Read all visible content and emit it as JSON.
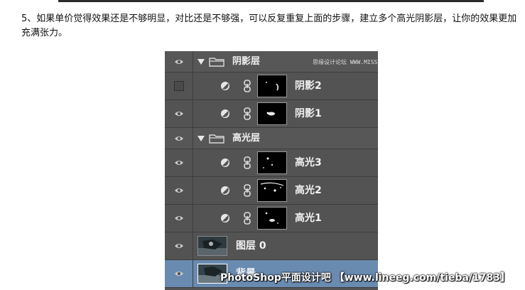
{
  "instruction": "5、如果单价觉得效果还是不够明显，对比还是不够强，可以反复重复上面的步骤，建立多个高光阴影层，让你的效果更加充满张力。",
  "layers": {
    "shadow_group": {
      "label": "阴影层",
      "visible": true,
      "expanded": true
    },
    "shadow2": {
      "label": "阴影2",
      "visible": false
    },
    "shadow1": {
      "label": "阴影1",
      "visible": true
    },
    "highlight_group": {
      "label": "高光层",
      "visible": true,
      "expanded": true
    },
    "highlight3": {
      "label": "高光3",
      "visible": true
    },
    "highlight2": {
      "label": "高光2",
      "visible": true
    },
    "highlight1": {
      "label": "高光1",
      "visible": true
    },
    "layer0": {
      "label": "图层 0",
      "visible": true
    },
    "background": {
      "label": "背景",
      "visible": true,
      "selected": true
    }
  },
  "watermarks": {
    "top": "思缘设计论坛 WWW.MISSYUAN.COM",
    "bottom": "PhotoShop平面设计吧 【www.lineeg.com/tieba/1783】"
  },
  "colors": {
    "panel_bg": "#535353",
    "row_border": "#3d3d3d",
    "selected_row": "#6a8bb0",
    "label_text": "#f2f2f2"
  },
  "icons": {
    "visibility": "eye-icon",
    "folder": "folder-icon",
    "expand": "triangle-down-icon",
    "adjustment": "adjustment-circle-icon",
    "link": "chain-link-icon"
  }
}
